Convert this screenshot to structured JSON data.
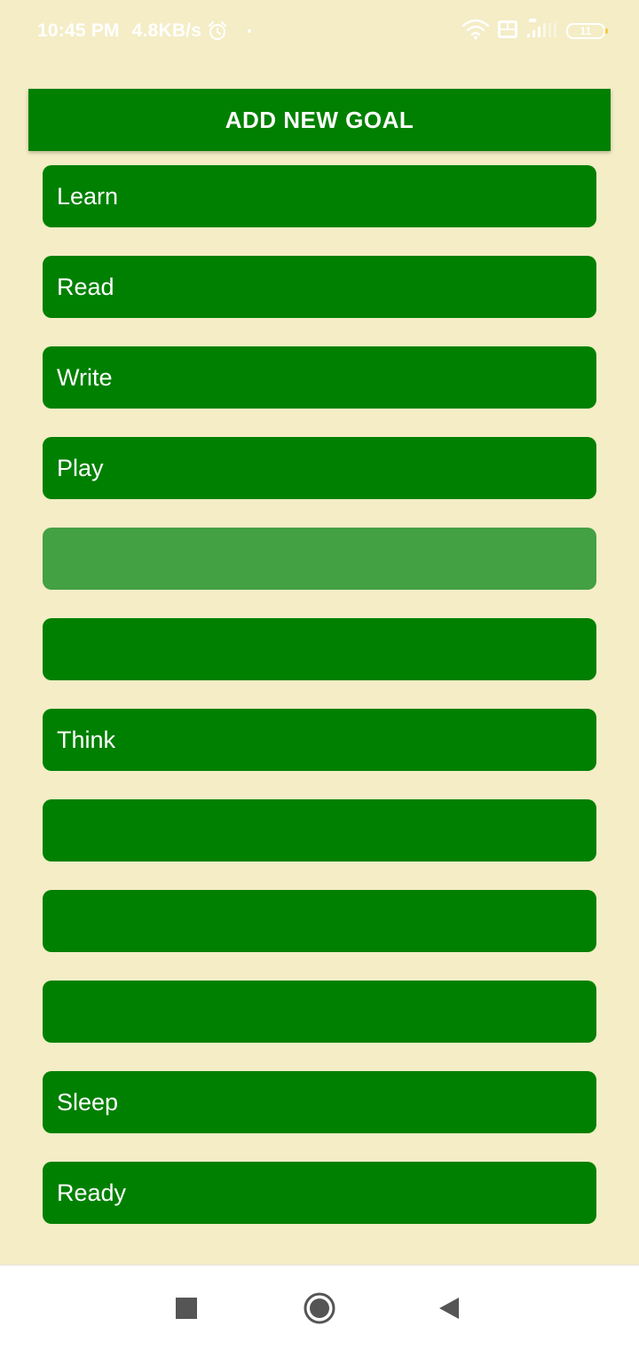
{
  "status_bar": {
    "time": "10:45 PM",
    "net_speed": "4.8KB/s",
    "battery_level": "11",
    "icons": [
      "alarm-icon",
      "dot-icon",
      "wifi-icon",
      "volte-icon",
      "signal-4g-icon",
      "battery-icon"
    ]
  },
  "header": {
    "add_goal_label": "ADD NEW GOAL"
  },
  "goals": [
    {
      "label": "Learn"
    },
    {
      "label": "Read"
    },
    {
      "label": "Write"
    },
    {
      "label": "Play"
    },
    {
      "label": ""
    },
    {
      "label": ""
    },
    {
      "label": "Think"
    },
    {
      "label": ""
    },
    {
      "label": ""
    },
    {
      "label": ""
    },
    {
      "label": "Sleep"
    },
    {
      "label": "Ready"
    }
  ],
  "nav_bar": {
    "icons": [
      "recents-square-icon",
      "home-circle-icon",
      "back-triangle-icon"
    ]
  },
  "colors": {
    "background": "#F4EDC6",
    "accent": "#008000",
    "pressed_item": "#43A043",
    "nav_bar": "#FFFFFF"
  }
}
